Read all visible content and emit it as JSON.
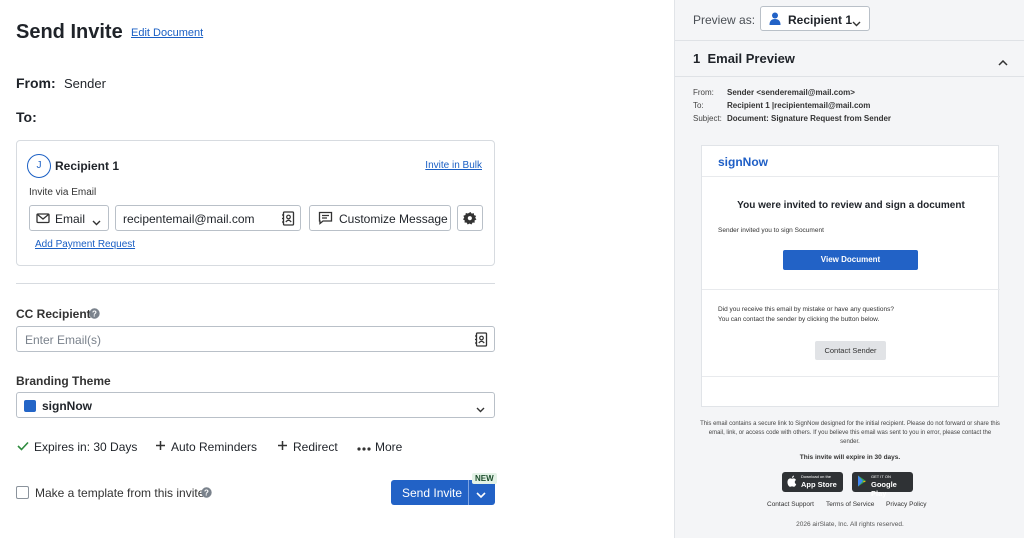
{
  "left": {
    "title": "Send Invite",
    "edit_document": "Edit Document",
    "from_label": "From:",
    "from_value": "Sender",
    "to_label": "To:",
    "recipient": {
      "initial": "J",
      "name": "Recipient 1",
      "invite_in_bulk": "Invite in Bulk",
      "invite_via": "Invite via Email",
      "method": "Email",
      "email_value": "recipentemail@mail.com",
      "customize_message": "Customize Message",
      "add_payment": "Add Payment Request"
    },
    "cc": {
      "label": "CC Recipients",
      "placeholder": "Enter Email(s)"
    },
    "branding": {
      "label": "Branding Theme",
      "value": "signNow",
      "swatch_color": "#2365c7"
    },
    "options": {
      "expires": "Expires in: 30 Days",
      "auto_reminders": "Auto Reminders",
      "redirect": "Redirect",
      "more": "More"
    },
    "template_label": "Make a template from this invite",
    "send_label": "Send Invite",
    "new_badge": "NEW"
  },
  "right": {
    "preview_as": "Preview as:",
    "recipient_select": "Recipient 1",
    "section_number": "1",
    "section_title": "Email Preview",
    "from_key": "From:",
    "from_val": "Sender <senderemail@mail.com>",
    "to_key": "To:",
    "to_val": "Recipient 1 |recipientemail@mail.com",
    "subject_key": "Subject:",
    "subject_val": "Document: Signature Request from Sender",
    "email": {
      "logo": "signNow",
      "heading": "You were invited to review and sign a document",
      "subtext": "Sender invited you to sign Socument",
      "view_button": "View Document",
      "question1": "Did you receive this email by mistake or have any questions?",
      "question2": "You can contact the sender by clicking the button below.",
      "contact_button": "Contact Sender"
    },
    "footer_note": "This email contains a secure link to SignNow designed for the initial recipient. Please do not forward or share this email, link, or access code with others. If you believe this email was sent to you in error, please contact the sender.",
    "expire_note": "This invite will expire in 30 days.",
    "app_store_small": "Download on the",
    "app_store_big": "App Store",
    "google_play_small": "GET IT ON",
    "google_play_big": "Google Play",
    "links": {
      "support": "Contact Support",
      "terms": "Terms of Service",
      "privacy": "Privacy Policy"
    },
    "copyright": "2026 airSlate, Inc. All rights reserved."
  },
  "colors": {
    "primary": "#2262c6",
    "link": "#1a5fc4",
    "success": "#2e8b3e"
  }
}
